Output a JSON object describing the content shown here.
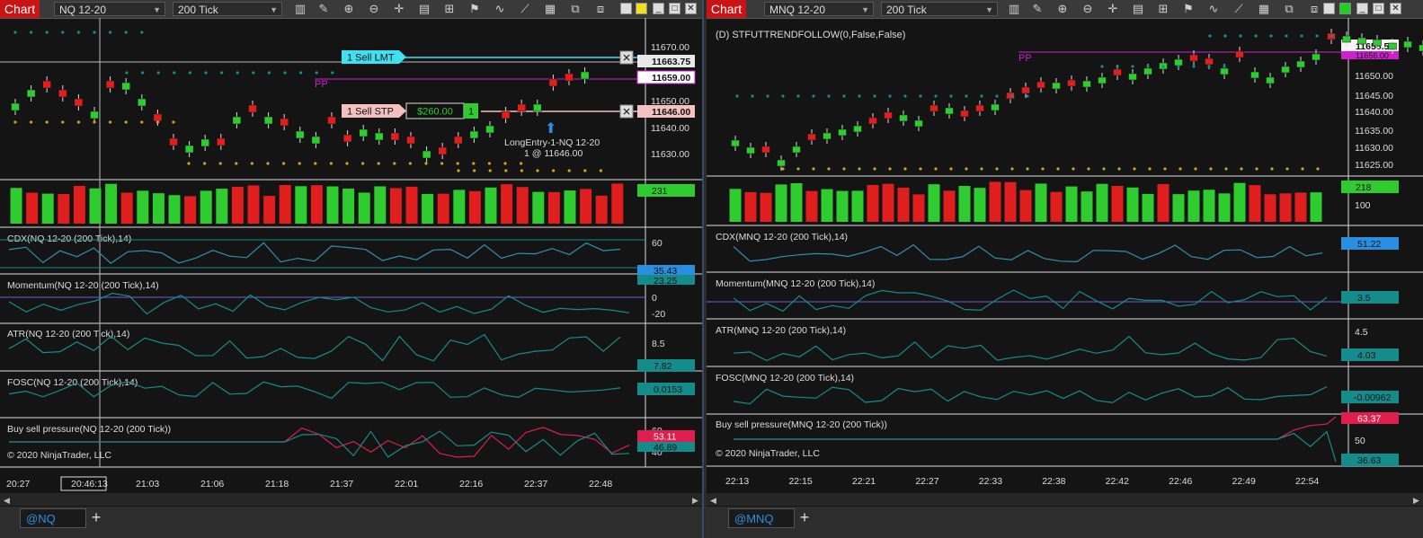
{
  "left": {
    "chart_label": "Chart",
    "instrument": "NQ 12-20",
    "interval": "200 Tick",
    "tab": "@NQ",
    "price_labels": [
      "11670.00",
      "11663.75",
      "11659.00",
      "11650.00",
      "11646.00",
      "11640.00",
      "11630.00"
    ],
    "vol_value": "231",
    "indicators": {
      "cdx": {
        "title": "CDX(NQ 12-20 (200 Tick),14)",
        "ticks": [
          "60"
        ],
        "badges": [
          "35.43",
          "23.25"
        ]
      },
      "mom": {
        "title": "Momentum(NQ 12-20 (200 Tick),14)",
        "ticks": [
          "0",
          "-20"
        ]
      },
      "atr": {
        "title": "ATR(NQ 12-20 (200 Tick),14)",
        "ticks": [
          "8.5"
        ],
        "badge": "7.82"
      },
      "fosc": {
        "title": "FOSC(NQ 12-20 (200 Tick),14)",
        "badge": "0.0153"
      },
      "bsp": {
        "title": "Buy sell pressure(NQ 12-20 (200 Tick))",
        "ticks": [
          "60",
          "40"
        ],
        "badges": [
          "53.11",
          "46.89"
        ]
      }
    },
    "copyright": "© 2020 NinjaTrader, LLC",
    "time_labels": [
      "20:27",
      "20:46:13",
      "21:03",
      "21:06",
      "21:18",
      "21:37",
      "22:01",
      "22:16",
      "22:37",
      "22:48"
    ],
    "orders": {
      "sell_lmt": "1  Sell LMT",
      "sell_stp": "1  Sell STP",
      "pnl": "$260.00",
      "qty": "1",
      "pp": "PP",
      "entry_line1": "LongEntry-1-NQ 12-20",
      "entry_line2": "1 @ 11646.00"
    }
  },
  "right": {
    "chart_label": "Chart",
    "instrument": "MNQ 12-20",
    "interval": "200 Tick",
    "tab": "@MNQ",
    "strategy": "(D) STFUTTRENDFOLLOW(0,False,False)",
    "pp": "PP",
    "price_labels": [
      "11658.50",
      "11656.00",
      "11650.00",
      "11645.00",
      "11640.00",
      "11635.00",
      "11630.00",
      "11625.00"
    ],
    "vol_value": "218",
    "vol_tick": "100",
    "indicators": {
      "cdx": {
        "title": "CDX(MNQ 12-20 (200 Tick),14)",
        "badge": "51.22"
      },
      "mom": {
        "title": "Momentum(MNQ 12-20 (200 Tick),14)",
        "badge": "3.5"
      },
      "atr": {
        "title": "ATR(MNQ 12-20 (200 Tick),14)",
        "ticks": [
          "4.5"
        ],
        "badge": "4.03"
      },
      "fosc": {
        "title": "FOSC(MNQ 12-20 (200 Tick),14)",
        "badge": "-0.00962"
      },
      "bsp": {
        "title": "Buy sell pressure(MNQ 12-20 (200 Tick))",
        "ticks": [
          "50"
        ],
        "badges": [
          "63.37",
          "36.63"
        ]
      }
    },
    "copyright": "© 2020 NinjaTrader, LLC",
    "time_labels": [
      "22:13",
      "22:15",
      "22:21",
      "22:27",
      "22:33",
      "22:38",
      "22:42",
      "22:46",
      "22:49",
      "22:54"
    ]
  },
  "colors": {
    "up": "#2ecc2e",
    "down": "#e01e1e",
    "line": "#2f8fb0",
    "teal": "#148c8c",
    "pp": "#cc22cc",
    "cyan": "#3fe0f0"
  },
  "icons": [
    "bar-chart-icon",
    "pencil-icon",
    "zoom-in-icon",
    "zoom-out-icon",
    "crosshair-icon",
    "data-box-icon",
    "properties-icon",
    "strategy-icon",
    "indicator-icon",
    "template-icon",
    "close-icon",
    "maximize-icon",
    "minimize-icon",
    "restore-icon"
  ]
}
